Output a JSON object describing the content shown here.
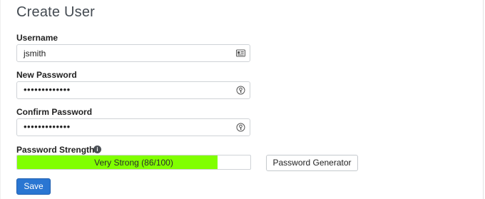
{
  "page": {
    "title": "Create User"
  },
  "form": {
    "username": {
      "label": "Username",
      "value": "jsmith",
      "icon": "id-card-icon"
    },
    "new_password": {
      "label": "New Password",
      "value": "•••••••••••••",
      "icon": "key-icon"
    },
    "confirm_password": {
      "label": "Confirm Password",
      "value": "•••••••••••••",
      "icon": "key-icon"
    },
    "strength": {
      "label": "Password Strength",
      "text": "Very Strong (86/100)",
      "score": 86,
      "max": 100,
      "fill_color": "#80ff00"
    },
    "generator_button": "Password Generator",
    "save_button": "Save"
  },
  "colors": {
    "primary": "#2a76d2",
    "strength": "#80ff00"
  }
}
